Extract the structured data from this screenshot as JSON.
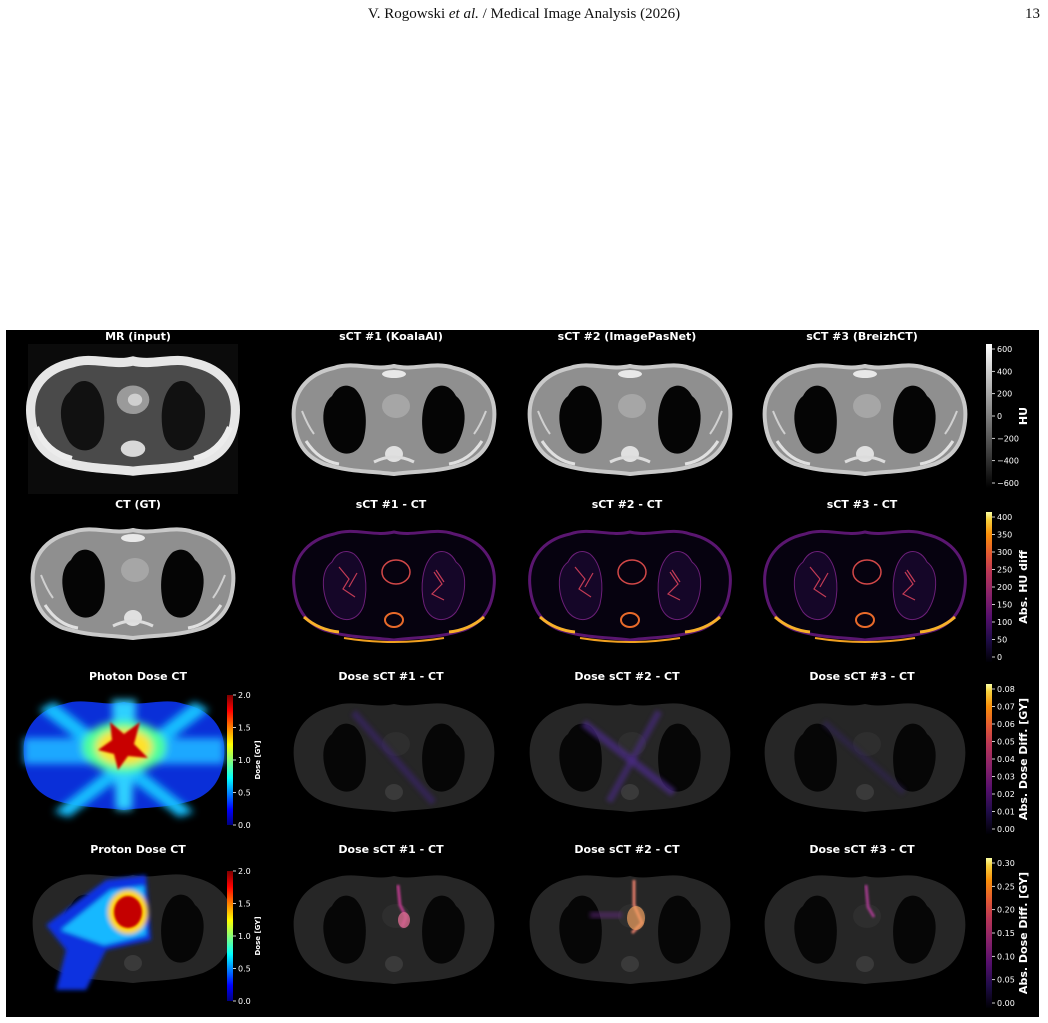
{
  "header": {
    "author_prefix": "V. Rogowski ",
    "author_etal": "et al.",
    "journal": " / Medical Image Analysis (2026)",
    "page_number": "13"
  },
  "figure": {
    "rows": [
      {
        "titles": [
          "MR (input)",
          "sCT #1 (KoalaAI)",
          "sCT #2 (ImagePasNet)",
          "sCT #3 (BreizhCT)"
        ],
        "colorbar": {
          "label": "HU",
          "ticks": [
            "600",
            "400",
            "200",
            "0",
            "−200",
            "−400",
            "−600"
          ],
          "colormap": "gray"
        }
      },
      {
        "titles": [
          "CT (GT)",
          "sCT #1 - CT",
          "sCT #2 - CT",
          "sCT #3 - CT"
        ],
        "colorbar": {
          "label": "Abs. HU diff",
          "ticks": [
            "400",
            "350",
            "300",
            "250",
            "200",
            "150",
            "100",
            "50",
            "0"
          ],
          "colormap": "inferno"
        }
      },
      {
        "titles": [
          "Photon Dose CT",
          "Dose sCT #1 - CT",
          "Dose sCT #2 - CT",
          "Dose sCT #3 - CT"
        ],
        "dose_colorbar": {
          "label": "Dose [GY]",
          "ticks": [
            "2.0",
            "1.5",
            "1.0",
            "0.5",
            "0.0"
          ],
          "colormap": "jet"
        },
        "colorbar": {
          "label": "Abs. Dose Diff. [GY]",
          "ticks": [
            "0.08",
            "0.07",
            "0.06",
            "0.05",
            "0.04",
            "0.03",
            "0.02",
            "0.01",
            "0.00"
          ],
          "colormap": "inferno"
        }
      },
      {
        "titles": [
          "Proton Dose CT",
          "Dose sCT #1 - CT",
          "Dose sCT #2 - CT",
          "Dose sCT #3 - CT"
        ],
        "dose_colorbar": {
          "label": "Dose [GY]",
          "ticks": [
            "2.0",
            "1.5",
            "1.0",
            "0.5",
            "0.0"
          ],
          "colormap": "jet"
        },
        "colorbar": {
          "label": "Abs. Dose Diff. [GY]",
          "ticks": [
            "0.30",
            "0.25",
            "0.20",
            "0.15",
            "0.10",
            "0.05",
            "0.00"
          ],
          "colormap": "inferno"
        }
      }
    ]
  }
}
